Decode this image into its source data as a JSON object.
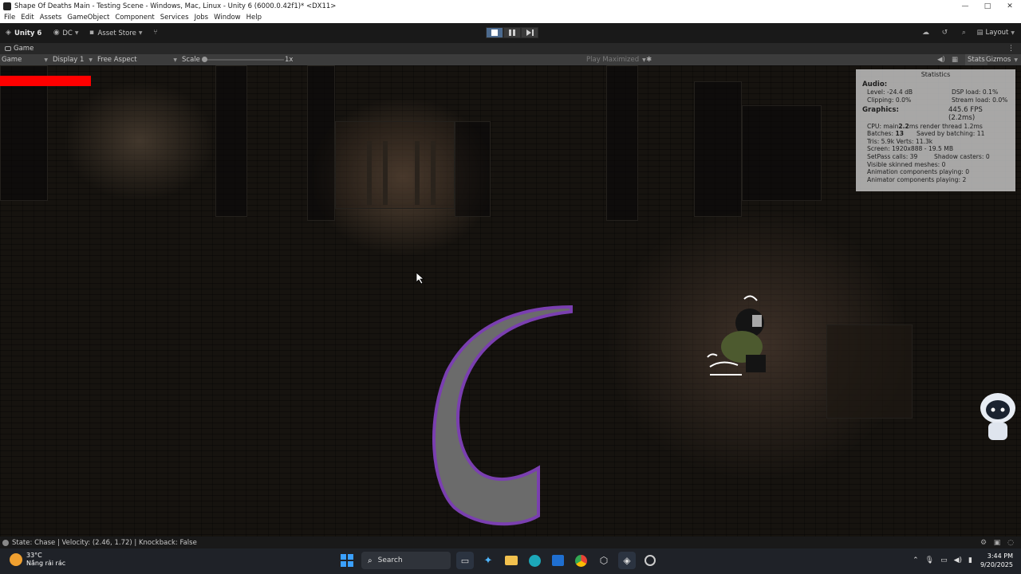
{
  "window": {
    "title": "Shape Of Deaths Main - Testing Scene - Windows, Mac, Linux - Unity 6 (6000.0.42f1)* <DX11>",
    "controls": [
      "—",
      "□",
      "✕"
    ]
  },
  "menu": [
    "File",
    "Edit",
    "Assets",
    "GameObject",
    "Component",
    "Services",
    "Jobs",
    "Window",
    "Help"
  ],
  "toolbar": {
    "unity_label": "Unity 6",
    "account_label": "DC",
    "asset_store_label": "Asset Store",
    "layout_label": "Layout"
  },
  "tab": {
    "label": "Game"
  },
  "game_toolbar": {
    "mode": "Game",
    "display": "Display 1",
    "aspect": "Free Aspect",
    "scale_label": "Scale",
    "scale_value": "1x",
    "play_maximized": "Play Maximized",
    "stats_label": "Stats",
    "gizmos_label": "Gizmos"
  },
  "health": {
    "fraction": 1.0
  },
  "stats": {
    "title": "Statistics",
    "audio_heading": "Audio:",
    "level": "Level: -24.4 dB",
    "dsp": "DSP load: 0.1%",
    "clipping": "Clipping: 0.0%",
    "stream": "Stream load: 0.0%",
    "graphics_heading": "Graphics:",
    "fps": "445.6 FPS (2.2ms)",
    "cpu_prefix": "CPU: main ",
    "cpu_main": "2.2",
    "cpu_suffix": "ms  render thread 1.2ms",
    "batches_prefix": "Batches: ",
    "batches": "13",
    "saved_batching": "Saved by batching: 11",
    "tris": "Tris: 5.9k   Verts: 11.3k",
    "screen": "Screen: 1920x888 - 19.5 MB",
    "setpass": "SetPass calls: 39",
    "shadow": "Shadow casters: 0",
    "skinned": "Visible skinned meshes: 0",
    "anim_components": "Animation components playing: 0",
    "animator_components": "Animator components playing: 2"
  },
  "status_bar": {
    "message": "State: Chase | Velocity: (2.46, 1.72) | Knockback: False"
  },
  "taskbar": {
    "weather_temp": "33°C",
    "weather_desc": "Nắng rải rác",
    "search_label": "Search",
    "time": "3:44 PM",
    "date": "9/20/2025"
  }
}
